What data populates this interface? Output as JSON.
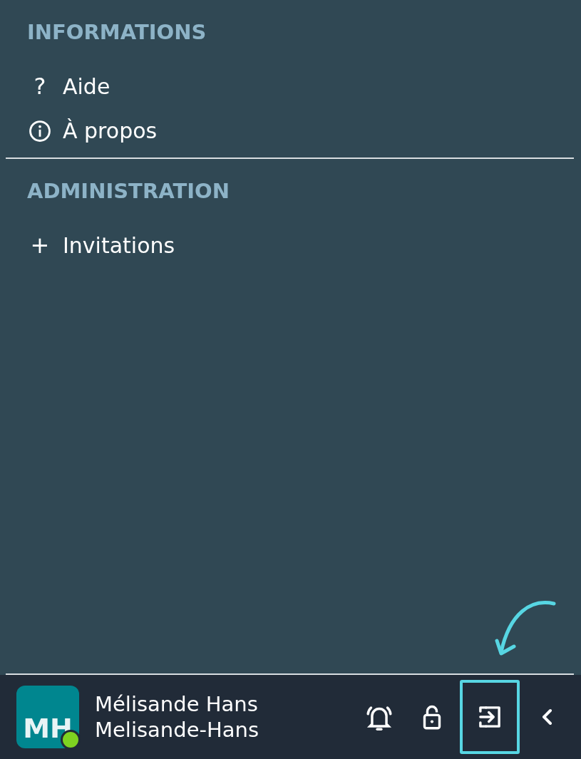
{
  "sections": [
    {
      "title": "INFORMATIONS",
      "items": [
        {
          "icon": "?",
          "label": "Aide",
          "kind": "glyph"
        },
        {
          "label": "À propos",
          "kind": "info"
        }
      ]
    },
    {
      "title": "ADMINISTRATION",
      "items": [
        {
          "icon": "+",
          "label": "Invitations",
          "kind": "glyph"
        }
      ]
    }
  ],
  "user": {
    "initials": "MH",
    "name": "Mélisande Hans",
    "username": "Melisande-Hans",
    "online": true
  },
  "actions": [
    {
      "kind": "bell",
      "highlighted": false
    },
    {
      "kind": "lock",
      "highlighted": false
    },
    {
      "kind": "logout",
      "highlighted": true
    },
    {
      "kind": "collapse",
      "highlighted": false
    }
  ]
}
